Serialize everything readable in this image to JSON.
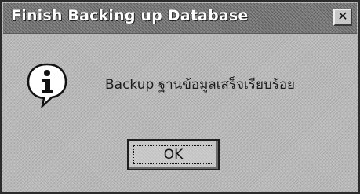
{
  "window": {
    "title": "Finish Backing up Database",
    "close_glyph": "✕"
  },
  "message": {
    "icon": "information-icon",
    "text": "Backup ฐานข้อมูลเสร็จเรียบร้อย"
  },
  "buttons": {
    "ok_label": "OK"
  }
}
